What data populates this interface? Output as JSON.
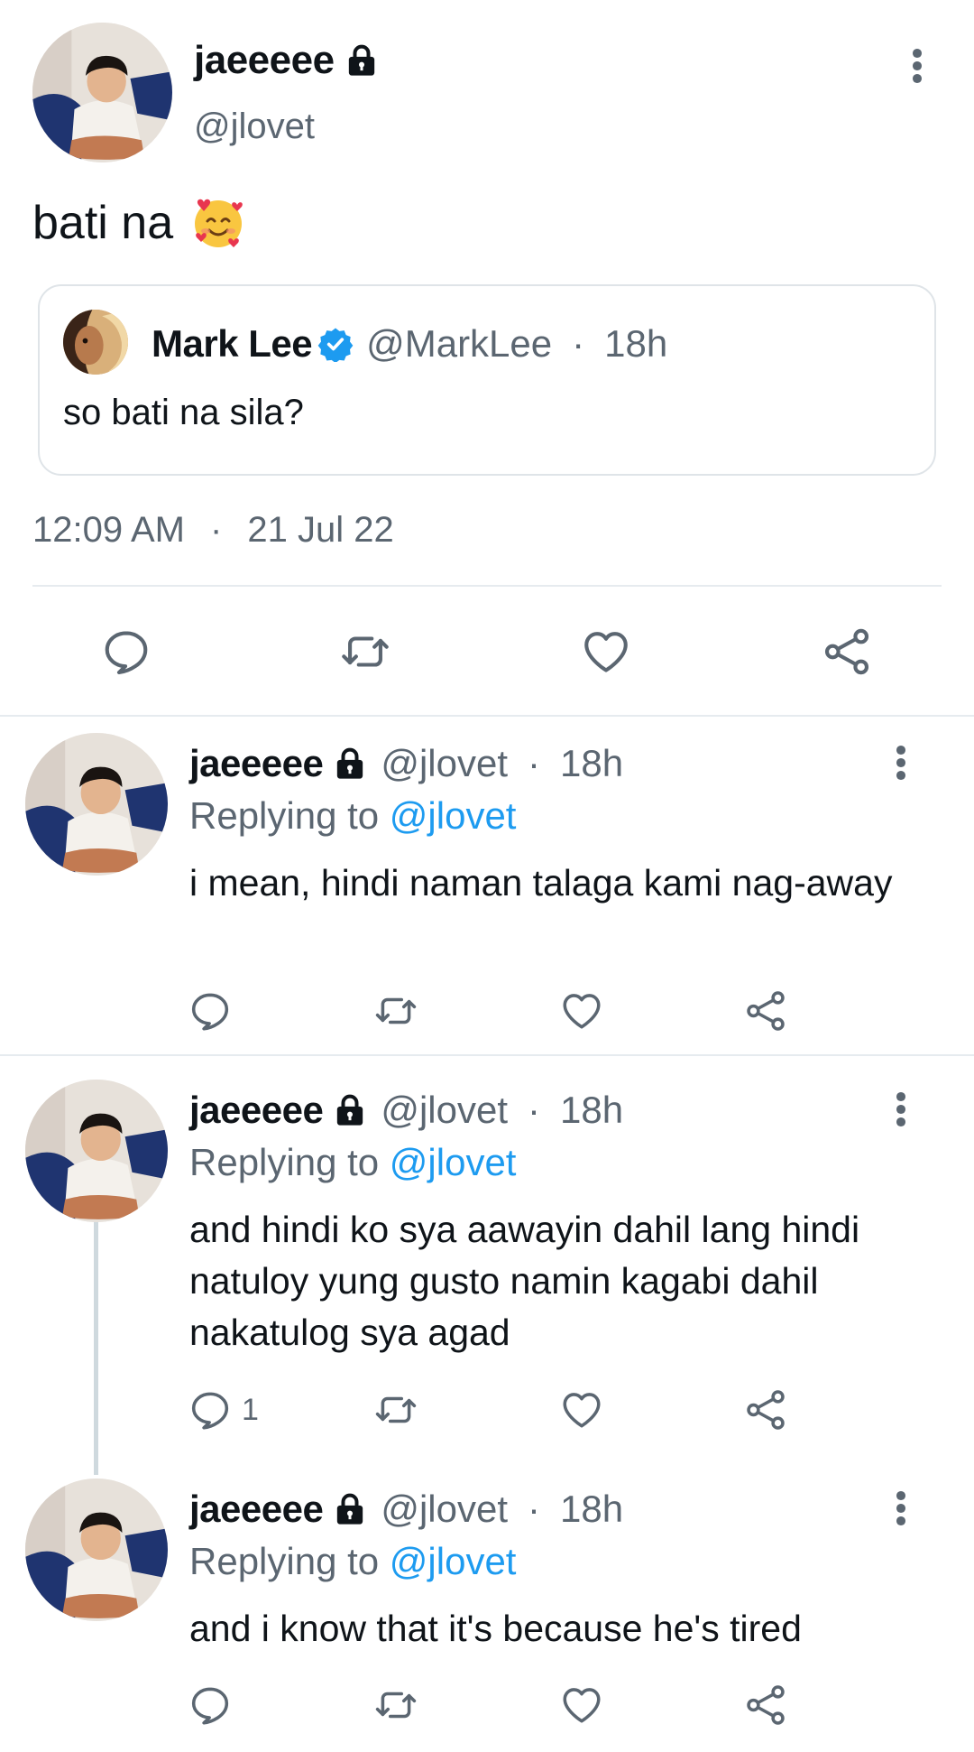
{
  "main_tweet": {
    "display_name": "jaeeeee",
    "handle": "@jlovet",
    "text": "bati na",
    "emoji": "smiling-face-with-hearts",
    "timestamp_time": "12:09 AM",
    "timestamp_sep": "·",
    "timestamp_date": "21 Jul 22"
  },
  "quoted_tweet": {
    "display_name": "Mark Lee",
    "handle": "@MarkLee",
    "sep": "·",
    "age": "18h",
    "text": "so bati na sila?"
  },
  "replies": [
    {
      "display_name": "jaeeeee",
      "handle": "@jlovet",
      "sep": "·",
      "age": "18h",
      "replying_prefix": "Replying to",
      "replying_to": "@jlovet",
      "text": "i mean, hindi naman talaga kami nag-away",
      "reply_count": ""
    },
    {
      "display_name": "jaeeeee",
      "handle": "@jlovet",
      "sep": "·",
      "age": "18h",
      "replying_prefix": "Replying to",
      "replying_to": "@jlovet",
      "text": "and hindi ko sya aawayin dahil lang hindi natuloy yung gusto namin kagabi dahil nakatulog sya agad",
      "reply_count": "1"
    },
    {
      "display_name": "jaeeeee",
      "handle": "@jlovet",
      "sep": "·",
      "age": "18h",
      "replying_prefix": "Replying to",
      "replying_to": "@jlovet",
      "text": "and i know that it's because he's tired",
      "reply_count": ""
    }
  ],
  "icons": {
    "reply": "reply-icon",
    "retweet": "retweet-icon",
    "like": "heart-icon",
    "share": "share-icon",
    "more": "more-vertical-icon",
    "lock": "lock-icon",
    "verified": "verified-badge-icon"
  },
  "colors": {
    "link": "#1d9bf0",
    "muted": "#5b6671",
    "divider": "#e6ebef",
    "verified": "#1d9bf0"
  }
}
